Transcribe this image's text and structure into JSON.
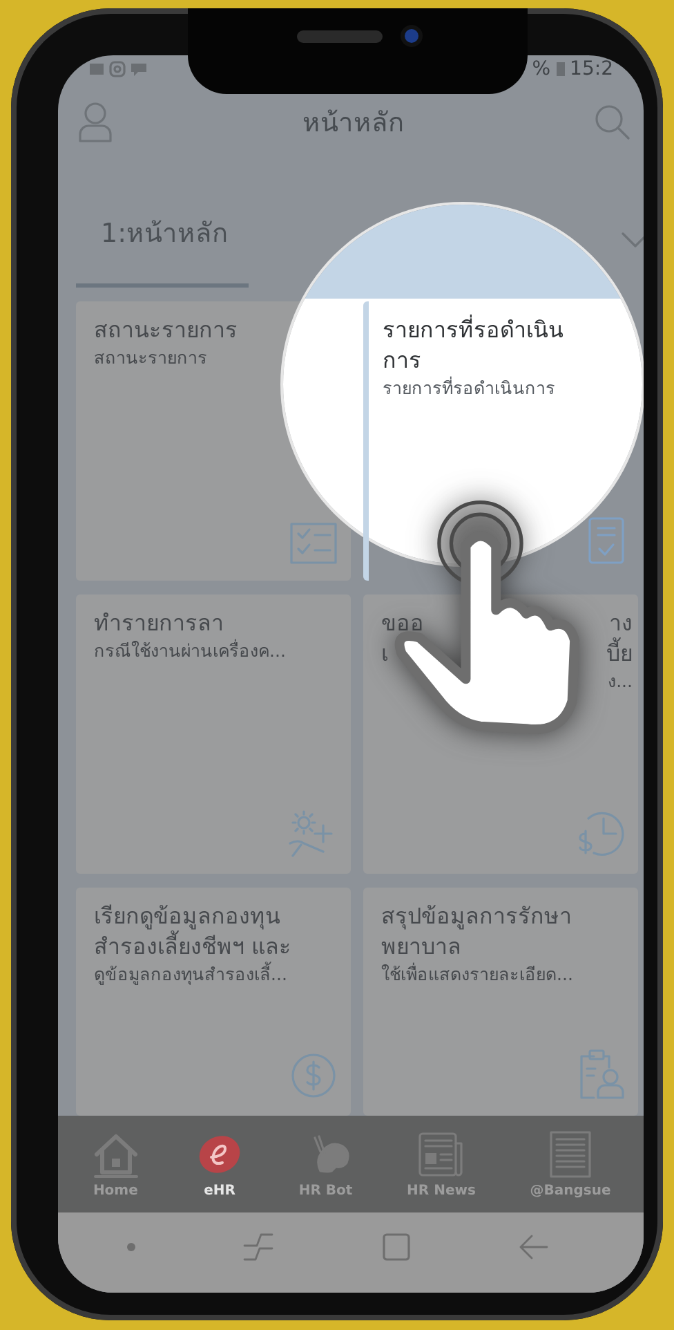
{
  "status_bar": {
    "time": "15:2",
    "battery": "%"
  },
  "app_bar": {
    "title": "หน้าหลัก"
  },
  "tabs": [
    {
      "label": "1:หน้าหลัก",
      "selected": true
    }
  ],
  "cards": [
    {
      "title": "สถานะรายการ",
      "subtitle": "สถานะรายการ",
      "magnified": false
    },
    {
      "title": "รายการที่รอดำเนินการ",
      "subtitle": "รายการที่รอดำเนินการ",
      "magnified": true
    },
    {
      "title": "ทำรายการลา",
      "subtitle": "กรณีใช้งานผ่านเครื่องค...",
      "magnified": false
    },
    {
      "covered_lines": [
        {
          "kind": "title",
          "left": "ขออ",
          "right": "าง"
        },
        {
          "kind": "title",
          "left": "เ",
          "right": "บี้ย"
        },
        {
          "kind": "subtitle",
          "right": "ง..."
        }
      ],
      "magnified": false
    },
    {
      "title": "เรียกดูข้อมูลกองทุนสำรองเลี้ยงชีพฯ และ",
      "subtitle": "ดูข้อมูลกองทุนสำรองเลี้...",
      "magnified": false
    },
    {
      "title": "สรุปข้อมูลการรักษาพยาบาล",
      "subtitle": "ใช้เพื่อแสดงรายละเอียด...",
      "magnified": false
    }
  ],
  "bottom_nav": [
    {
      "label": "Home",
      "selected": false
    },
    {
      "label": "eHR",
      "selected": true
    },
    {
      "label": "HR Bot",
      "selected": false
    },
    {
      "label": "HR News",
      "selected": false
    },
    {
      "label": "@Bangsue",
      "selected": false
    }
  ]
}
